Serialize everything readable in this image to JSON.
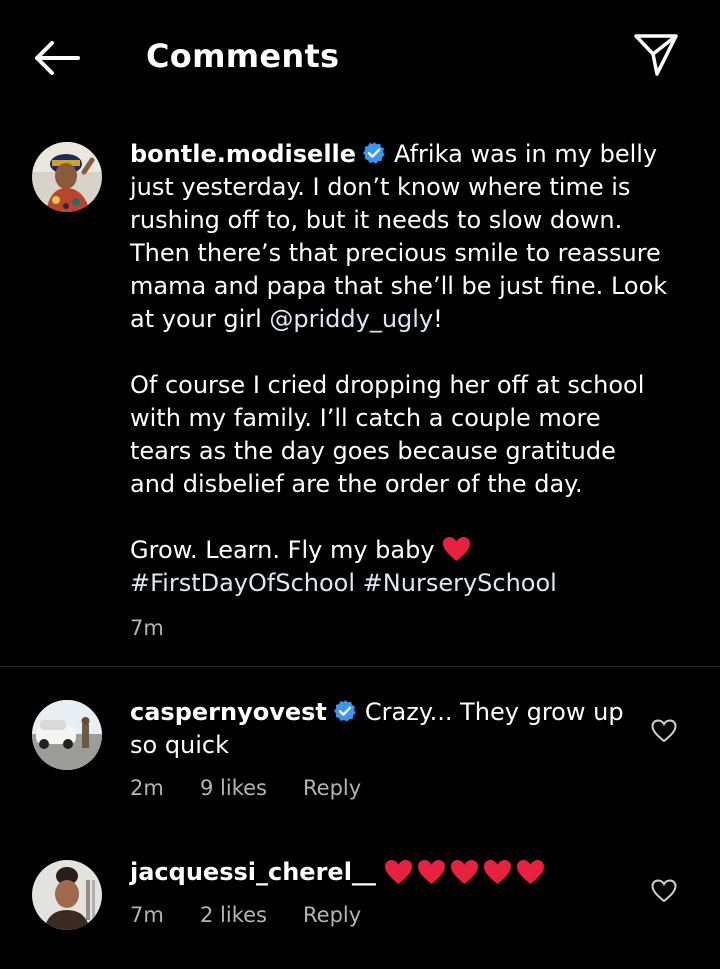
{
  "header": {
    "title": "Comments",
    "back_icon": "arrow-left-icon",
    "share_icon": "paper-plane-icon"
  },
  "post": {
    "username": "bontle.modiselle",
    "verified": true,
    "caption_line1": "Afrika was in my belly",
    "caption_line2": "just yesterday. I don’t know where time is",
    "caption_line3": "rushing off to, but it needs to slow down.",
    "caption_line4": "Then there’s that precious smile to reassure",
    "caption_line5": "mama and papa that she’ll be just fine. Look",
    "caption_line6_prefix": "at your girl ",
    "mention": "@priddy_ugly",
    "caption_line6_suffix": "!",
    "paragraph2_line1": "Of course I cried dropping her off at school",
    "paragraph2_line2": "with my family. I’ll catch a couple more",
    "paragraph2_line3": "tears as the day goes because gratitude",
    "paragraph2_line4": "and disbelief are the order of the day.",
    "paragraph3_text": "Grow. Learn. Fly my baby",
    "hashtag1": "#FirstDayOfSchool",
    "hashtag2": "#NurserySchool",
    "time": "7m"
  },
  "comments": [
    {
      "username": "caspernyovest",
      "verified": true,
      "text_line1": "Crazy... They grow up",
      "text_line2": "so quick",
      "time": "2m",
      "likes": "9 likes",
      "reply": "Reply"
    },
    {
      "username": "jacquessi_cherel__",
      "verified": false,
      "heart_count": 5,
      "time": "7m",
      "likes": "2 likes",
      "reply": "Reply"
    }
  ],
  "colors": {
    "background": "#000000",
    "text": "#ffffff",
    "meta": "#b4b4b4",
    "verified": "#3897f0",
    "heart": "#e8213f"
  }
}
